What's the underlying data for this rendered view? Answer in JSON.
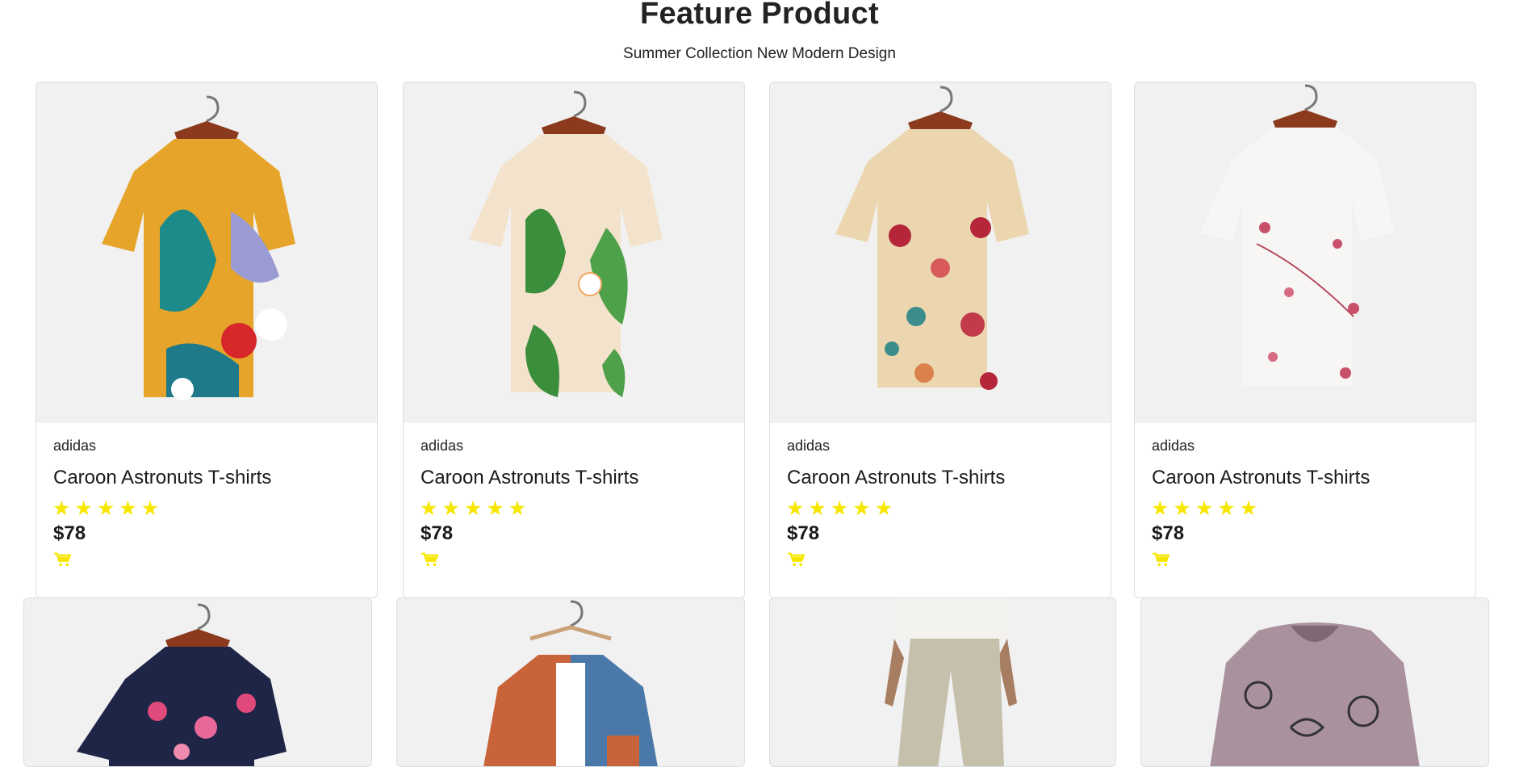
{
  "section": {
    "title": "Feature Product",
    "subtitle": "Summer Collection New Modern Design"
  },
  "products": [
    {
      "brand": "adidas",
      "name": "Caroon Astronuts T-shirts",
      "price": "$78",
      "rating": 5,
      "icon": "floral-shirt-multicolor"
    },
    {
      "brand": "adidas",
      "name": "Caroon Astronuts T-shirts",
      "price": "$78",
      "rating": 5,
      "icon": "floral-shirt-green-leaf"
    },
    {
      "brand": "adidas",
      "name": "Caroon Astronuts T-shirts",
      "price": "$78",
      "rating": 5,
      "icon": "floral-shirt-cream-roses"
    },
    {
      "brand": "adidas",
      "name": "Caroon Astronuts T-shirts",
      "price": "$78",
      "rating": 5,
      "icon": "floral-shirt-white-pink"
    }
  ],
  "second_row_icons": [
    "navy-floral-shirt",
    "orange-blue-shirt",
    "linen-pants",
    "grey-cat-print-blouse"
  ],
  "colors": {
    "star": "#f7e600",
    "cart": "#f7e600",
    "image_bg": "#f1f1f1"
  }
}
